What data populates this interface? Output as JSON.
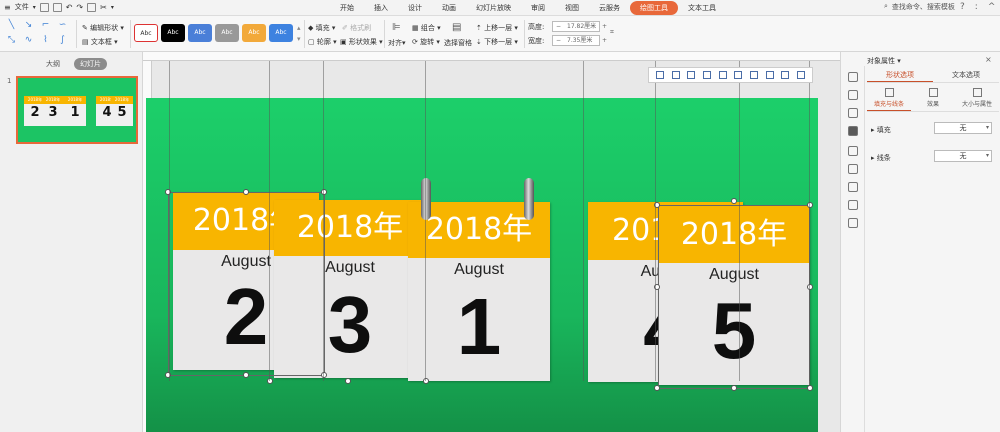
{
  "menu": {
    "file": "文件",
    "tabs": [
      "开始",
      "插入",
      "设计",
      "动画",
      "幻灯片放映",
      "审阅",
      "视图",
      "云服务",
      "绘图工具",
      "文本工具"
    ],
    "active_tab": "绘图工具",
    "search_text": "查找命令、搜索模板",
    "help": "?",
    "colon": ":",
    "collapse": "^"
  },
  "ribbon": {
    "edit_shape": "编辑形状",
    "text_box": "文本框",
    "style_label": "Abc",
    "fill": "填充",
    "format_painter": "格式刷",
    "outline": "轮廓",
    "shape_effect": "形状效果",
    "align": "对齐",
    "group": "组合",
    "rotate": "旋转",
    "selection_pane": "选择窗格",
    "bring_forward": "上移一层",
    "send_backward": "下移一层",
    "height_label": "高度:",
    "height_value": "17.82厘米",
    "width_label": "宽度:",
    "width_value": "7.35厘米"
  },
  "left_panel": {
    "tab_outline": "大纲",
    "tab_slides": "幻灯片",
    "slide_number": "1"
  },
  "cards": [
    {
      "year": "2018年",
      "month": "August",
      "day": "2"
    },
    {
      "year": "2018年",
      "month": "August",
      "day": "3"
    },
    {
      "year": "2018年",
      "month": "August",
      "day": "1"
    },
    {
      "year": "2018年",
      "month": "August",
      "day": "4"
    },
    {
      "year": "2018年",
      "month": "August",
      "day": "5"
    }
  ],
  "right_panel": {
    "title": "对象属性",
    "close": "×",
    "tab_shape": "形状选项",
    "tab_text": "文本选项",
    "sub_fill_line": "填充与线条",
    "sub_effect": "效果",
    "sub_size": "大小与属性",
    "fill_label": "填充",
    "fill_value": "无",
    "line_label": "线条",
    "line_value": "无"
  },
  "colors": {
    "accent": "#e8683a",
    "slide_green": "#1ccf6a",
    "card_yellow": "#f8b500"
  }
}
